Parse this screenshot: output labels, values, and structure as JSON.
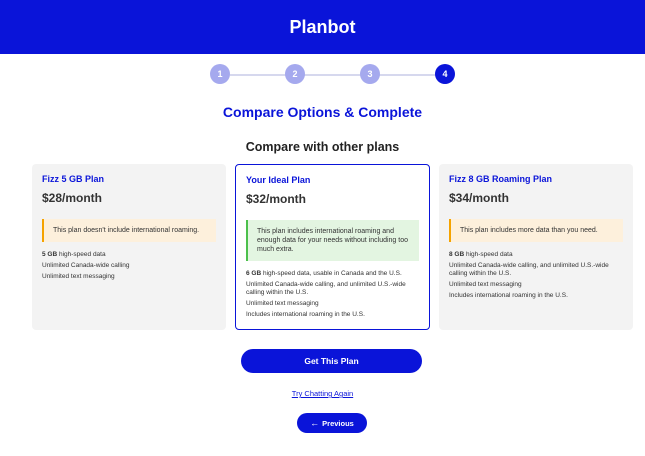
{
  "header": {
    "title": "Planbot"
  },
  "stepper": {
    "steps": [
      {
        "label": "1",
        "state": "done"
      },
      {
        "label": "2",
        "state": "done"
      },
      {
        "label": "3",
        "state": "done"
      },
      {
        "label": "4",
        "state": "active"
      }
    ]
  },
  "page": {
    "title": "Compare Options & Complete",
    "subtitle": "Compare with other plans"
  },
  "plans": [
    {
      "name": "Fizz 5 GB Plan",
      "price": "$28/month",
      "note": "This plan doesn't include international roaming.",
      "note_type": "warn",
      "features": [
        {
          "bold": "5 GB",
          "text": " high-speed data"
        },
        {
          "bold": "",
          "text": "Unlimited Canada-wide calling"
        },
        {
          "bold": "",
          "text": "Unlimited text messaging"
        }
      ]
    },
    {
      "name": "Your Ideal Plan",
      "price": "$32/month",
      "note": "This plan includes international roaming and enough data for your needs without including too much extra.",
      "note_type": "good",
      "features": [
        {
          "bold": "6 GB",
          "text": " high-speed data, usable in Canada and the U.S."
        },
        {
          "bold": "",
          "text": "Unlimited Canada-wide calling, and unlimited U.S.-wide calling within the U.S."
        },
        {
          "bold": "",
          "text": "Unlimited text messaging"
        },
        {
          "bold": "",
          "text": "Includes international roaming in the U.S."
        }
      ]
    },
    {
      "name": "Fizz 8 GB Roaming Plan",
      "price": "$34/month",
      "note": "This plan includes more data than you need.",
      "note_type": "warn",
      "features": [
        {
          "bold": "8 GB",
          "text": " high-speed data"
        },
        {
          "bold": "",
          "text": "Unlimited Canada-wide calling, and unlimited U.S.-wide calling within the U.S."
        },
        {
          "bold": "",
          "text": "Unlimited text messaging"
        },
        {
          "bold": "",
          "text": "Includes international roaming in the U.S."
        }
      ]
    }
  ],
  "actions": {
    "get_plan": "Get This Plan",
    "try_again": "Try Chatting Again",
    "previous": "Previous",
    "previous_icon": "arrow-left-icon"
  },
  "colors": {
    "brand": "#0a14d9",
    "step_done": "#a5a9ee",
    "warn_bg": "#fdf0dc",
    "good_bg": "#e3f5e1"
  }
}
